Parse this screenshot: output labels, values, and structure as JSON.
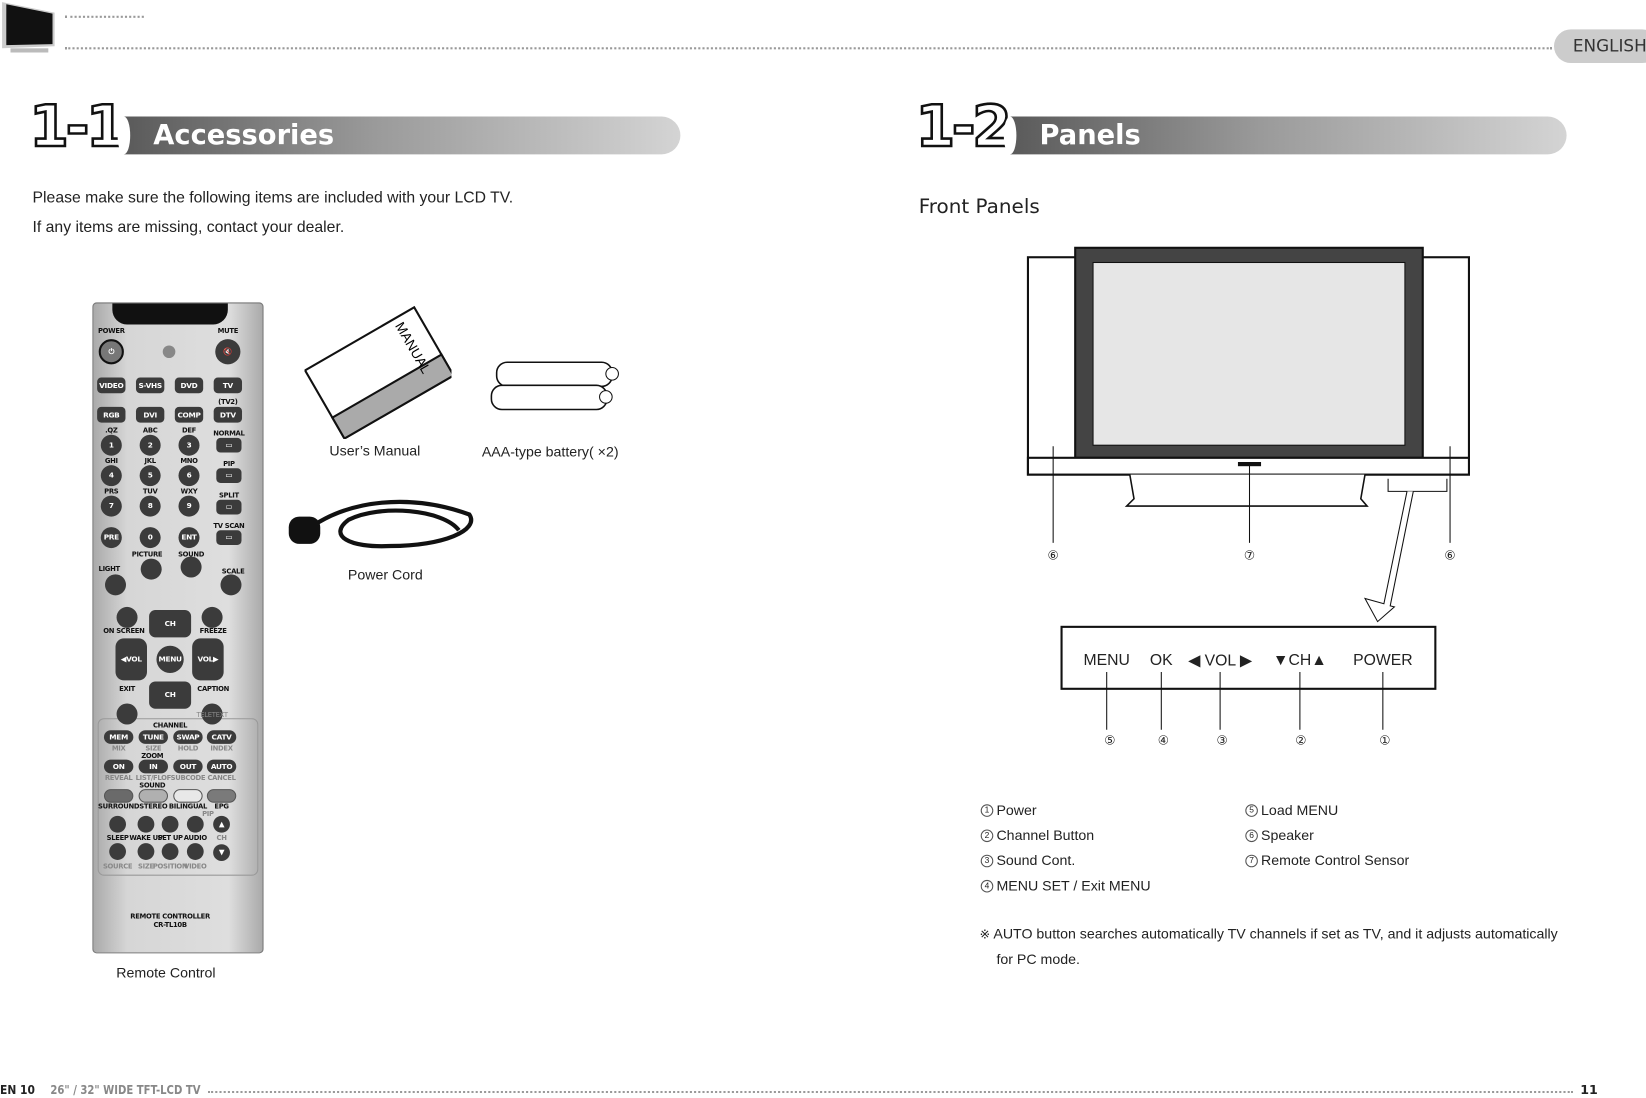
{
  "header": {
    "language": "ENGLISH"
  },
  "footer": {
    "page_left": "EN 10",
    "product": "26\" / 32\" WIDE TFT-LCD TV",
    "page_right": "11"
  },
  "accessories": {
    "number": "1-1.",
    "title": "Accessories",
    "intro": [
      "Please make sure the following items are included with your LCD TV.",
      "If any items are missing, contact your dealer."
    ],
    "items": {
      "manual": "User’s Manual",
      "manual_cover": "MANUAL",
      "battery": "AAA-type battery( ×2)",
      "cord": "Power Cord",
      "remote": "Remote Control"
    }
  },
  "remote": {
    "top": [
      {
        "label": "POWER"
      },
      {
        "label": "MUTE"
      }
    ],
    "source_row1": [
      "VIDEO",
      "S-VHS",
      "DVD",
      "TV"
    ],
    "source_row2": [
      "RGB",
      "DVI",
      "COMP",
      "DTV"
    ],
    "tv2": "(TV2)",
    "numbers": [
      [
        "1",
        ".QZ"
      ],
      [
        "2",
        "ABC"
      ],
      [
        "3",
        "DEF"
      ],
      [
        "4",
        "GHI"
      ],
      [
        "5",
        "JKL"
      ],
      [
        "6",
        "MNO"
      ],
      [
        "7",
        "PRS"
      ],
      [
        "8",
        "TUV"
      ],
      [
        "9",
        "WXY"
      ],
      [
        "PRE",
        ""
      ],
      [
        "0",
        ""
      ],
      [
        "ENT",
        ""
      ]
    ],
    "side": [
      "NORMAL",
      "PIP",
      "SPLIT",
      "TV SCAN"
    ],
    "arc": [
      "LIGHT",
      "PICTURE",
      "SOUND",
      "SCALE"
    ],
    "dpad": {
      "up": "CH",
      "down": "CH",
      "left": "◀VOL",
      "right": "VOL▶",
      "center": "MENU"
    },
    "corner": [
      "ON SCREEN",
      "FREEZE",
      "EXIT",
      "CAPTION"
    ],
    "teletext": "TELETEXT",
    "groups": {
      "channel": "CHANNEL",
      "zoom": "ZOOM",
      "sound": "SOUND",
      "pip": "PIP"
    },
    "channel_btns": [
      "MEM",
      "TUNE",
      "SWAP",
      "CATV"
    ],
    "channel_sub": [
      "MIX",
      "SIZE",
      "HOLD",
      "INDEX"
    ],
    "zoom_btns": [
      "ON",
      "IN",
      "OUT",
      "AUTO"
    ],
    "zoom_sub": [
      "REVEAL",
      "LIST/FLOF",
      "SUBCODE",
      "CANCEL"
    ],
    "sound_lbls": [
      "SURROUND",
      "STEREO",
      "BILINGUAL",
      "EPG"
    ],
    "sleep_lbls": [
      "SLEEP",
      "WAKE UP",
      "SET UP",
      "AUDIO"
    ],
    "bottom_lbls": [
      "SOURCE",
      "SIZE",
      "POSITION",
      "VIDEO"
    ],
    "pip_ch": "CH",
    "brand": [
      "REMOTE CONTROLLER",
      "CR-TL10B"
    ]
  },
  "colors": {
    "sound_buttons": [
      "#6a6a6a",
      "#b0b0b0",
      "#e8e8e8",
      "#7a7a7a"
    ]
  },
  "panels": {
    "number": "1-2.",
    "title": "Panels",
    "subtitle": "Front Panels",
    "tv_callouts": [
      "⑥",
      "⑦",
      "⑥"
    ],
    "controls": [
      "MENU",
      "OK",
      "◀ VOL ▶",
      "▼CH▲",
      "POWER"
    ],
    "control_nums": [
      "⑤",
      "④",
      "③",
      "②",
      "①"
    ],
    "legend": [
      [
        "1",
        "Power"
      ],
      [
        "2",
        "Channel Button"
      ],
      [
        "3",
        "Sound Cont."
      ],
      [
        "4",
        "MENU SET / Exit MENU"
      ],
      [
        "5",
        "Load MENU"
      ],
      [
        "6",
        "Speaker"
      ],
      [
        "7",
        "Remote Control Sensor"
      ]
    ],
    "note_mark": "※",
    "note": [
      "AUTO button searches automatically TV channels if set as TV, and it adjusts automatically",
      "for PC mode."
    ]
  }
}
